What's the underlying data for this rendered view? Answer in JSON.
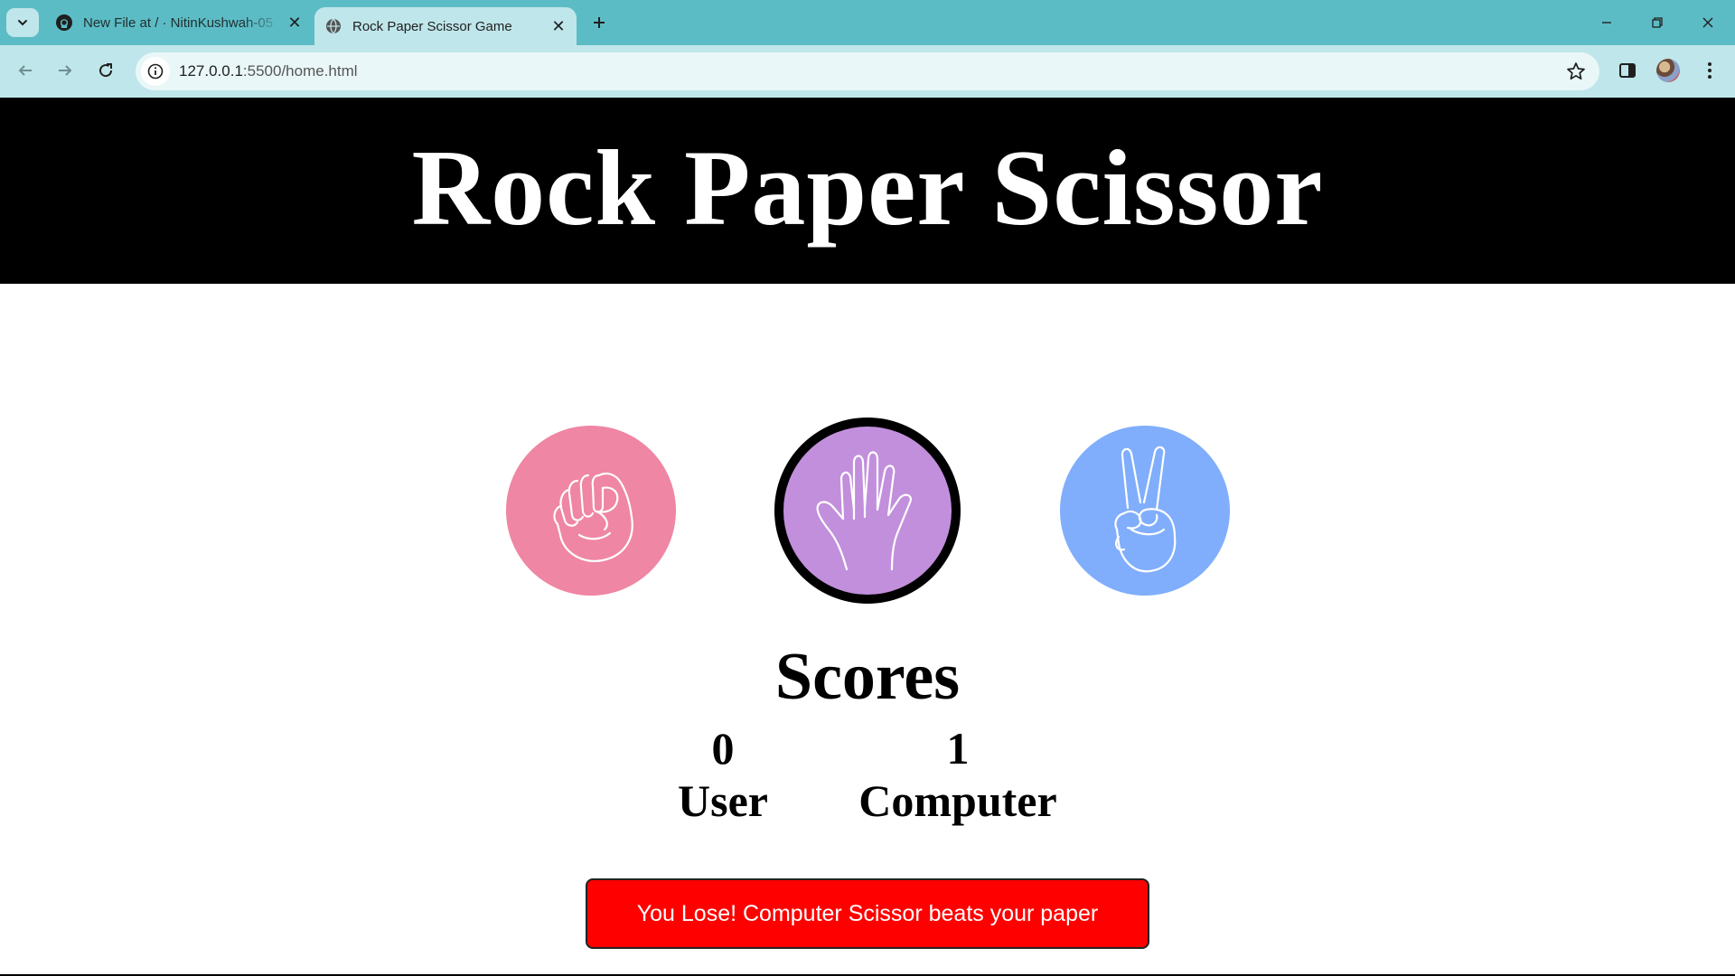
{
  "browser": {
    "tabs": [
      {
        "title": "New File at / · NitinKushwah-05",
        "icon": "github-icon",
        "active": false
      },
      {
        "title": "Rock Paper Scissor Game",
        "icon": "globe-icon",
        "active": true
      }
    ],
    "url_host": "127.0.0.1",
    "url_path": ":5500/home.html"
  },
  "page": {
    "title": "Rock Paper Scissor",
    "choices": [
      {
        "name": "rock",
        "icon": "fist-icon",
        "color": "#ef86a3",
        "selected": false
      },
      {
        "name": "paper",
        "icon": "open-hand-icon",
        "color": "#c28fdc",
        "selected": true
      },
      {
        "name": "scissor",
        "icon": "peace-hand-icon",
        "color": "#80aefc",
        "selected": false
      }
    ],
    "scores": {
      "heading": "Scores",
      "user_score": "0",
      "user_label": "User",
      "computer_score": "1",
      "computer_label": "Computer"
    },
    "message": "You Lose! Computer Scissor beats your paper",
    "message_color": "#ff0000"
  }
}
